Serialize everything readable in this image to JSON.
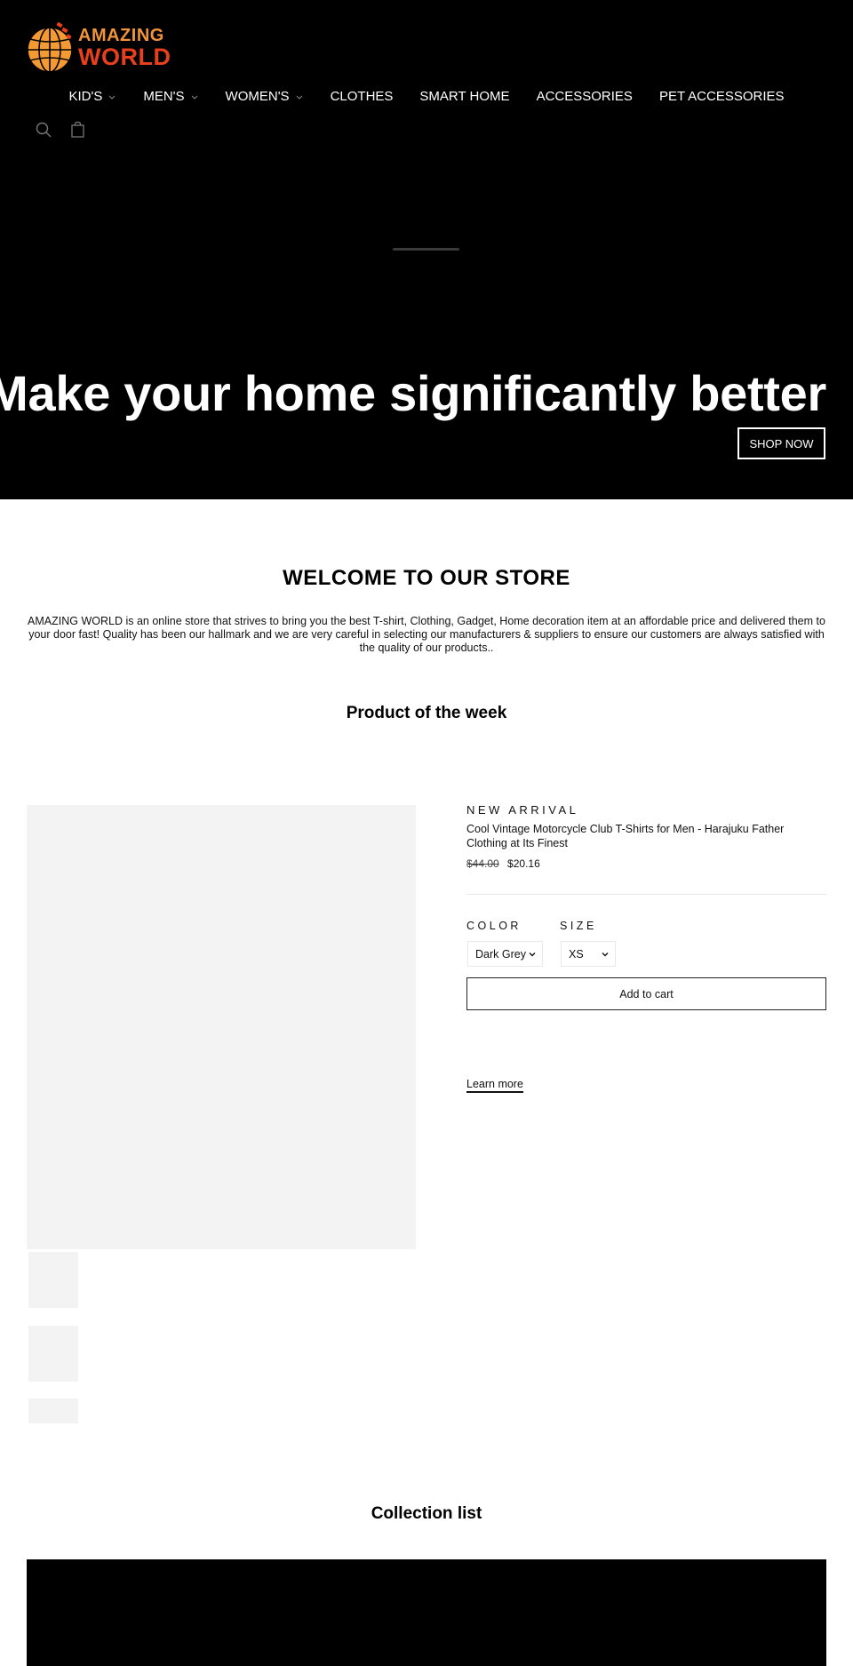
{
  "header": {
    "logo": {
      "line1": "AMAZING",
      "line2": "WORLD",
      "colors": {
        "top": "#f0923a",
        "bottom": "#e8401c",
        "globe": "#f39a33"
      }
    },
    "nav": [
      {
        "label": "KID'S",
        "has_dropdown": true
      },
      {
        "label": "MEN'S",
        "has_dropdown": true
      },
      {
        "label": "WOMEN'S",
        "has_dropdown": true
      },
      {
        "label": "CLOTHES",
        "has_dropdown": false
      },
      {
        "label": "SMART HOME",
        "has_dropdown": false
      },
      {
        "label": "ACCESSORIES",
        "has_dropdown": false
      },
      {
        "label": "PET ACCESSORIES",
        "has_dropdown": false
      }
    ],
    "icons": {
      "search": "search-icon",
      "cart": "cart-bag-icon"
    }
  },
  "hero": {
    "title": "Make your home significantly better",
    "button": "SHOP NOW"
  },
  "welcome": {
    "title": "WELCOME TO OUR STORE",
    "text": "AMAZING WORLD is an online store that strives to bring you the best T-shirt, Clothing, Gadget, Home decoration item at an affordable price and delivered them to your door fast! Quality has been our hallmark and we are very careful in selecting our manufacturers & suppliers to ensure our customers are always satisfied with the quality of our products.."
  },
  "product_week": {
    "section_title": "Product of the week",
    "label": "NEW ARRIVAL",
    "title": "Cool Vintage Motorcycle Club T-Shirts for Men - Harajuku Father Clothing at Its Finest",
    "price_old": "$44.00",
    "price_new": "$20.16",
    "color_label": "COLOR",
    "color_value": "Dark Grey",
    "size_label": "SIZE",
    "size_value": "XS",
    "add_to_cart": "Add to cart",
    "learn_more": "Learn more"
  },
  "collection": {
    "title": "Collection list"
  }
}
